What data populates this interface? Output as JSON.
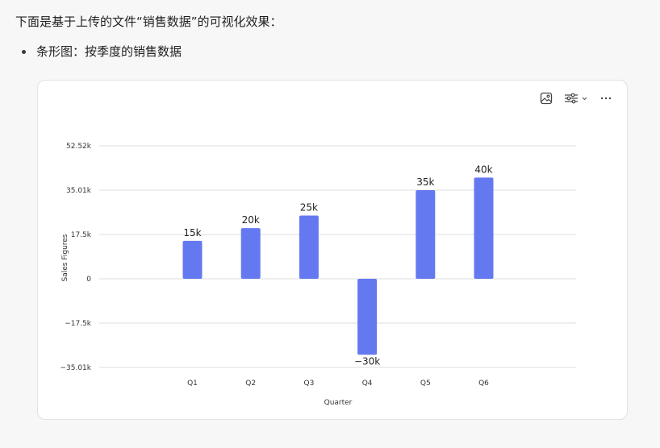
{
  "message": {
    "intro": "下面是基于上传的文件“销售数据”的可视化效果：",
    "bullet": "条形图：按季度的销售数据"
  },
  "toolbar": {
    "image_icon": "image-icon",
    "settings_icon": "sliders-icon",
    "dropdown_icon": "chevron-down-icon",
    "more_icon": "more-icon"
  },
  "colors": {
    "bar": "#6479f0",
    "grid": "#dcdcdc"
  },
  "chart_data": {
    "type": "bar",
    "categories": [
      "Q1",
      "Q2",
      "Q3",
      "Q4",
      "Q5",
      "Q6"
    ],
    "values": [
      15000,
      20000,
      25000,
      -30000,
      35000,
      40000
    ],
    "data_labels": [
      "15k",
      "20k",
      "25k",
      "−30k",
      "35k",
      "40k"
    ],
    "xlabel": "Quarter",
    "ylabel": "Sales Figures",
    "yticks": [
      52520,
      35010,
      17500,
      0,
      -17500,
      -35010
    ],
    "ytick_labels": [
      "52.52k",
      "35.01k",
      "17.5k",
      "0",
      "−17.5k",
      "−35.01k"
    ],
    "ylim": [
      -35010,
      52520
    ],
    "grid": true
  }
}
